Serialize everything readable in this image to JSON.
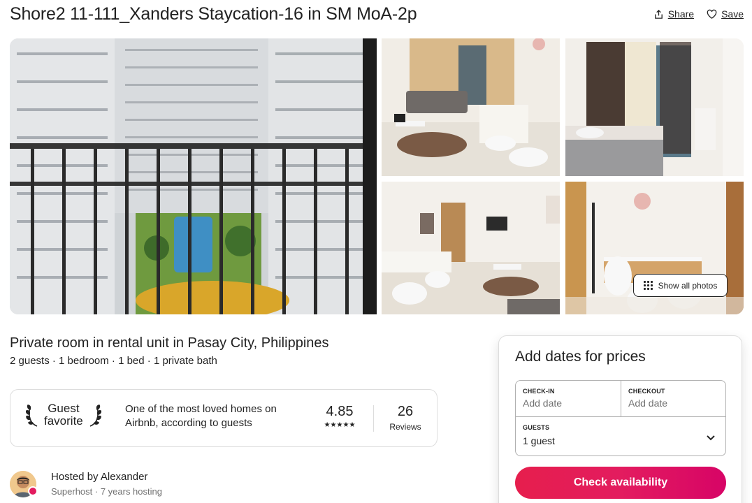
{
  "listing": {
    "title": "Shore2 11-111_Xanders Staycation-16 in SM MoA-2p",
    "share_label": "Share",
    "save_label": "Save",
    "show_all_photos_label": "Show all photos",
    "subtitle": "Private room in rental unit in Pasay City, Philippines",
    "details": "2 guests · 1 bedroom · 1 bed · 1 private bath"
  },
  "guest_favorite": {
    "badge_line1": "Guest",
    "badge_line2": "favorite",
    "description": "One of the most loved homes on Airbnb, according to guests",
    "rating": "4.85",
    "stars": "★★★★★",
    "review_count": "26",
    "reviews_label": "Reviews"
  },
  "host": {
    "name_line": "Hosted by Alexander",
    "meta_line": "Superhost · 7 years hosting"
  },
  "booking": {
    "heading": "Add dates for prices",
    "checkin_label": "CHECK-IN",
    "checkin_value": "Add date",
    "checkout_label": "CHECKOUT",
    "checkout_value": "Add date",
    "guests_label": "GUESTS",
    "guests_value": "1 guest",
    "button_label": "Check availability"
  },
  "colors": {
    "brand": "#e31c5f",
    "text": "#222222",
    "muted": "#717171",
    "border": "#dddddd"
  },
  "icons": [
    "share-icon",
    "heart-icon",
    "grid-icon",
    "laurel-left-icon",
    "laurel-right-icon",
    "chevron-down-icon"
  ]
}
